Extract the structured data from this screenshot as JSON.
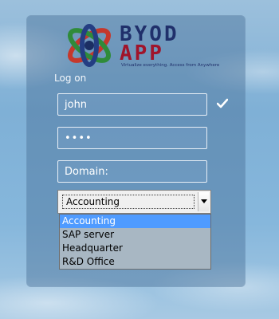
{
  "logo": {
    "title_line_1": "BYOD",
    "title_line_2": "APP",
    "tagline": "Virtualize everything. Access from Anywhere"
  },
  "form": {
    "heading": "Log on",
    "username_value": "john",
    "password_value": "••••",
    "domain_placeholder": "Domain:",
    "domain_select": {
      "selected": "Accounting",
      "options": [
        "Accounting",
        "SAP server",
        "Headquarter",
        "R&D Office"
      ]
    }
  },
  "icons": {
    "validation": "checkmark-icon"
  },
  "colors": {
    "panel_overlay": "#466e96",
    "select_highlight": "#4f9bff",
    "logo_blue": "#20306b",
    "logo_red": "#a0142a"
  }
}
